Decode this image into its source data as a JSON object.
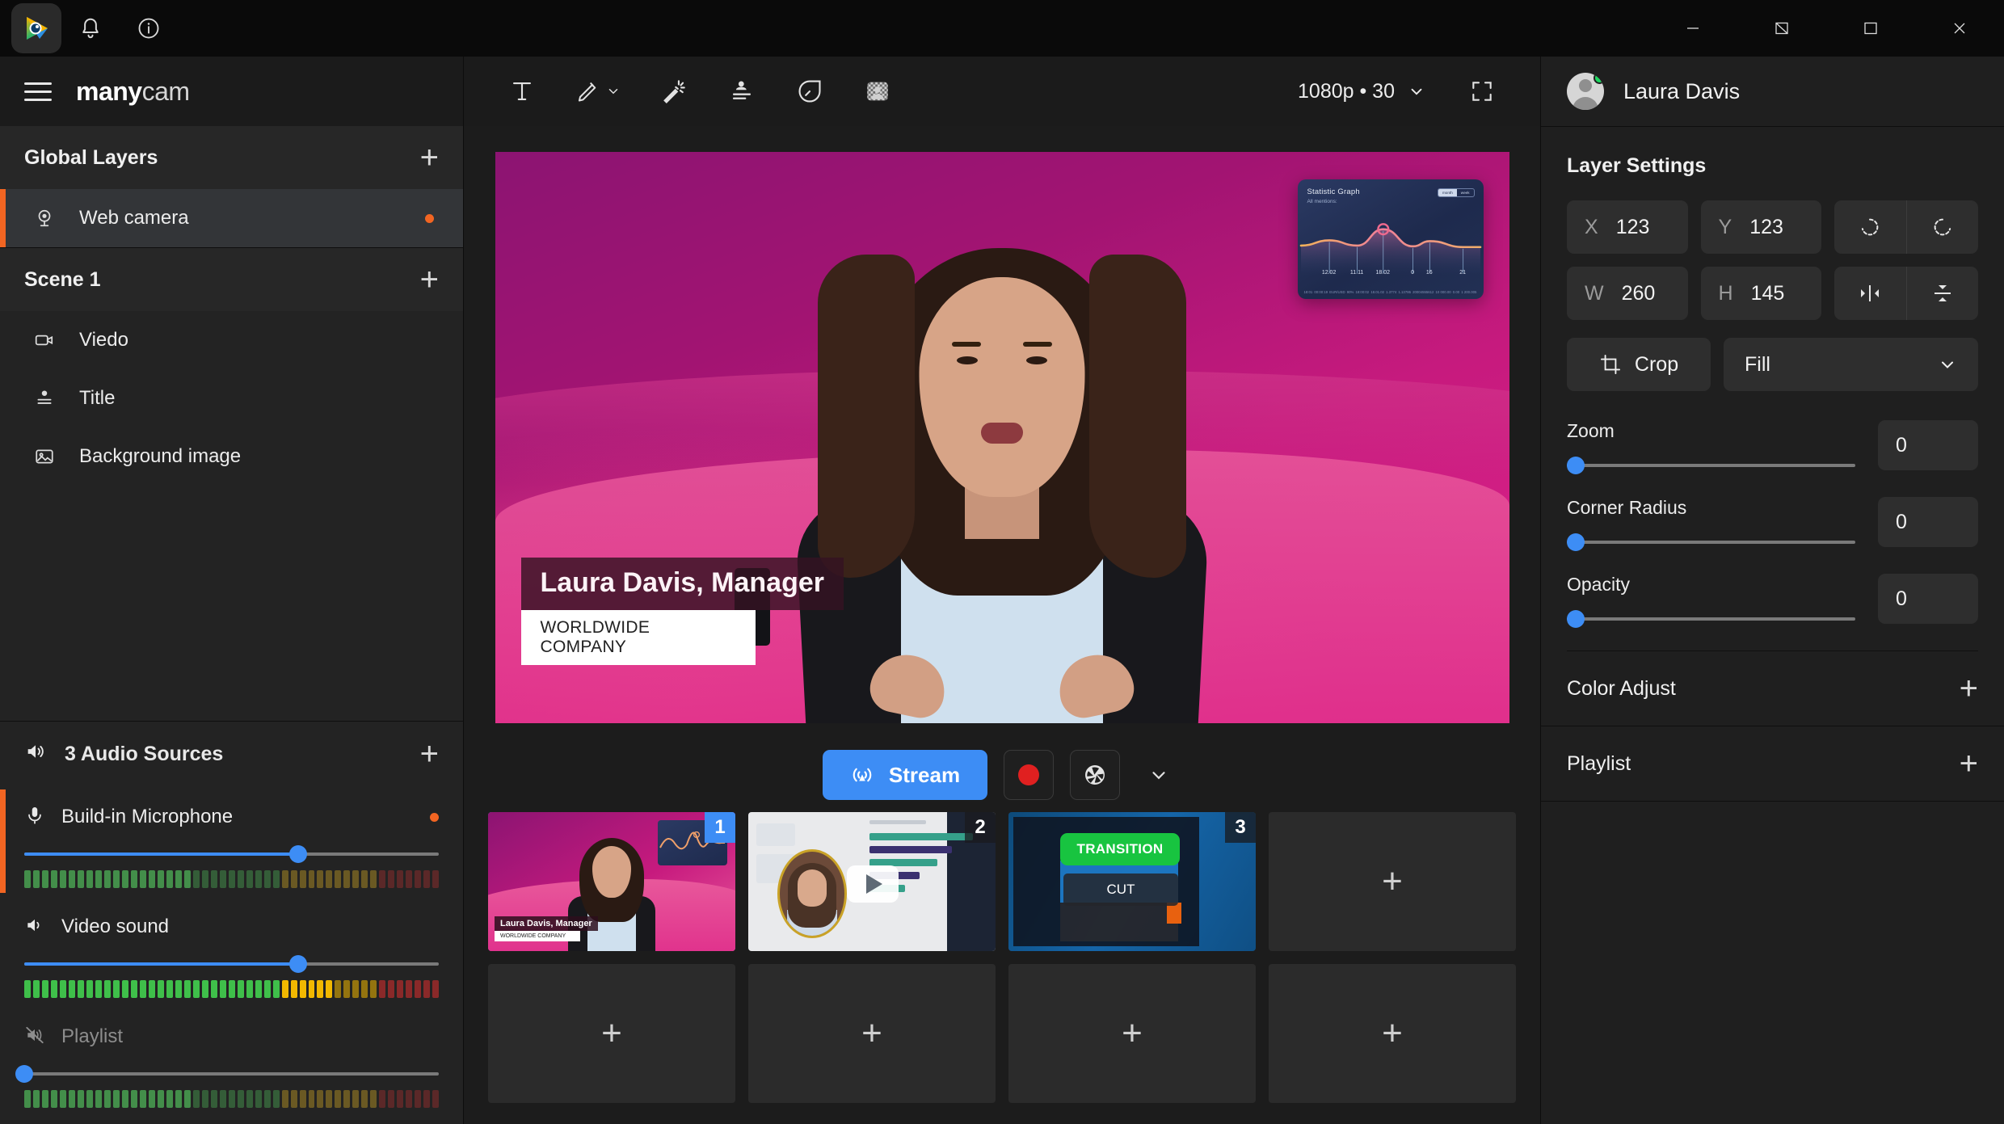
{
  "titlebar": {
    "icons": [
      "app-logo",
      "bell-icon",
      "info-icon"
    ],
    "window_buttons": [
      "minimize",
      "restore-down",
      "maximize",
      "close"
    ]
  },
  "brand": {
    "bold": "many",
    "light": "cam"
  },
  "sidebar": {
    "global_layers": {
      "title": "Global Layers",
      "add": "+"
    },
    "global_items": [
      {
        "label": "Web camera",
        "icon": "webcam-icon",
        "selected": true,
        "dot": true
      }
    ],
    "scene": {
      "title": "Scene 1",
      "add": "+"
    },
    "scene_items": [
      {
        "label": "Viedo",
        "icon": "video-camera-icon"
      },
      {
        "label": "Title",
        "icon": "title-icon"
      },
      {
        "label": "Background image",
        "icon": "image-icon"
      }
    ]
  },
  "audio": {
    "header": "3 Audio Sources",
    "add": "+",
    "sources": [
      {
        "label": "Build-in Microphone",
        "icon": "microphone-icon",
        "volume": 66,
        "active": true,
        "muted": false,
        "rec_dot": true,
        "meter_level": 62,
        "dim": true
      },
      {
        "label": "Video sound",
        "icon": "speaker-icon",
        "volume": 66,
        "active": false,
        "muted": false,
        "rec_dot": false,
        "meter_level": 74,
        "dim": false
      },
      {
        "label": "Playlist",
        "icon": "speaker-muted-icon",
        "volume": 0,
        "active": false,
        "muted": true,
        "rec_dot": false,
        "meter_level": 62,
        "dim": true
      }
    ]
  },
  "toolbar": {
    "tools": [
      {
        "name": "text-tool",
        "icon": "text-icon"
      },
      {
        "name": "draw-tool",
        "icon": "pencil-icon",
        "has_chevron": true
      },
      {
        "name": "effects-tool",
        "icon": "magic-wand-icon"
      },
      {
        "name": "lower-third-tool",
        "icon": "person-lines-icon"
      },
      {
        "name": "timer-tool",
        "icon": "stopwatch-icon"
      },
      {
        "name": "chroma-key-tool",
        "icon": "checkerboard-person-icon"
      }
    ],
    "resolution": "1080p • 30",
    "fullscreen": "fullscreen-icon"
  },
  "preview": {
    "lower_third": {
      "line1": "Laura Davis, Manager",
      "line2": "WORLDWIDE COMPANY"
    },
    "graph": {
      "title": "Statistic Graph",
      "subtitle": "All mentions:",
      "toggle": [
        "month",
        "week"
      ],
      "toggle_selected": "month",
      "footer": [
        "18:01",
        "00:00:19",
        "EUR/USD",
        "90%",
        "18:00:02",
        "18.01.02",
        "1.3774",
        "1.13786",
        "20004555612",
        "10 000.00",
        "0.00",
        "1 200.005"
      ]
    }
  },
  "chart_data": {
    "type": "line",
    "title": "Statistic Graph",
    "subtitle": "All mentions:",
    "xlabel": "",
    "ylabel": "",
    "categories": [
      "12.02",
      "11.11",
      "18.02",
      "0",
      "16",
      "21"
    ],
    "tick_positions_pct": [
      17,
      32,
      46,
      62,
      71,
      89
    ],
    "values": [
      62,
      48,
      92,
      46,
      60,
      44
    ],
    "highlight_point": {
      "label": "18.02",
      "value": 92
    },
    "grid": false,
    "legend": "none"
  },
  "controls": {
    "stream": "Stream",
    "record": "record-button",
    "snapshot": "snapshot-button",
    "more": "chevron-down-icon"
  },
  "thumbnails": {
    "row1": [
      {
        "number": "1",
        "selected": true,
        "kind": "scene-preview",
        "caption1": "Laura Davis, Manager",
        "caption2": "WORLDWIDE COMPANY"
      },
      {
        "number": "2",
        "selected": false,
        "kind": "video-scene"
      },
      {
        "number": "3",
        "selected": false,
        "kind": "desktop-scene",
        "overlay1": "TRANSITION",
        "overlay2": "CUT"
      },
      {
        "number": "",
        "selected": false,
        "kind": "add",
        "label": "+"
      }
    ],
    "row2": [
      {
        "number": "",
        "kind": "add",
        "label": "+"
      },
      {
        "number": "",
        "kind": "add",
        "label": "+"
      },
      {
        "number": "",
        "kind": "add",
        "label": "+"
      },
      {
        "number": "",
        "kind": "add",
        "label": "+"
      }
    ]
  },
  "right": {
    "user": {
      "name": "Laura Davis",
      "status": "online"
    },
    "layer_settings_title": "Layer Settings",
    "fields": [
      {
        "key": "X",
        "value": "123"
      },
      {
        "key": "Y",
        "value": "123"
      },
      {
        "key": "W",
        "value": "260"
      },
      {
        "key": "H",
        "value": "145"
      }
    ],
    "rotate_left": "rotate-left-icon",
    "rotate_right": "rotate-right-icon",
    "flip_horizontal": "flip-horizontal-icon",
    "flip_vertical": "flip-vertical-icon",
    "crop_label": "Crop",
    "fit_mode": "Fill",
    "sliders": [
      {
        "label": "Zoom",
        "value": "0",
        "pct": 0
      },
      {
        "label": "Corner Radius",
        "value": "0",
        "pct": 0
      },
      {
        "label": "Opacity",
        "value": "0",
        "pct": 0
      }
    ],
    "sections": [
      {
        "label": "Color Adjust",
        "add": "+"
      },
      {
        "label": "Playlist",
        "add": "+"
      }
    ]
  },
  "colors": {
    "accent_orange": "#f26522",
    "accent_blue": "#3d8df5",
    "record_red": "#e02020",
    "online_green": "#1ed760",
    "transition_green": "#18c440"
  }
}
